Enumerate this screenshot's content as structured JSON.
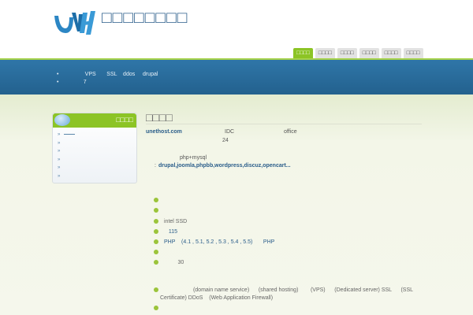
{
  "header": {
    "site_title": "□□□□□□□□",
    "logo_text": "UVH"
  },
  "nav": [
    {
      "label": "□□□□",
      "active": true
    },
    {
      "label": "□□□□"
    },
    {
      "label": "□□□□"
    },
    {
      "label": "□□□□"
    },
    {
      "label": "□□□□"
    },
    {
      "label": "□□□□"
    }
  ],
  "banner": {
    "items": [
      "              VPS       SSL    ddos     drupal",
      "             7"
    ]
  },
  "sidebar": {
    "title": "□□□□",
    "items": [
      "",
      "",
      "",
      "",
      "",
      ""
    ]
  },
  "main": {
    "title": "□□□□",
    "intro": {
      "domain": "unethost.com",
      "idc": "IDC",
      "office": "office",
      "hours": "24",
      "php": "php+mysql",
      "apps_prefix": ": ",
      "apps": "drupal,joomla,phpbb,wordpress,discuz,opencart..."
    },
    "features": [
      "",
      "",
      "intel SSD",
      "   115",
      "PHP    (4.1 , 5.1, 5.2 , 5.3 , 5.4 , 5.5)       PHP",
      "",
      "         30"
    ],
    "services_line1": "                   (domain name service)      (shared hosting)        (VPS)      (Dedicated server) SSL      (SSL",
    "services_line2": "Certificate) DDoS    (Web Application Firewall)"
  }
}
